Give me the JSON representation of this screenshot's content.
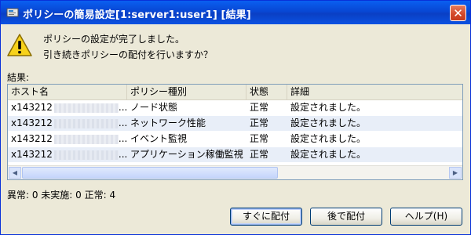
{
  "window": {
    "title": "ポリシーの簡易設定[1:server1:user1] [結果]",
    "close_glyph": "✕"
  },
  "message": {
    "line1": "ポリシーの設定が完了しました。",
    "line2": "引き続きポリシーの配付を行いますか？"
  },
  "result_label": "結果:",
  "table": {
    "columns": [
      "ホスト名",
      "ポリシー種別",
      "状態",
      "詳細"
    ],
    "rows": [
      {
        "host": "x143212",
        "host_suffix": "...",
        "policy": "ノード状態",
        "status": "正常",
        "detail": "設定されました。"
      },
      {
        "host": "x143212",
        "host_suffix": "...",
        "policy": "ネットワーク性能",
        "status": "正常",
        "detail": "設定されました。"
      },
      {
        "host": "x143212",
        "host_suffix": "...",
        "policy": "イベント監視",
        "status": "正常",
        "detail": "設定されました。"
      },
      {
        "host": "x143212",
        "host_suffix": "...",
        "policy": "アプリケーション稼働監視",
        "status": "正常",
        "detail": "設定されました。"
      }
    ]
  },
  "scrollbar": {
    "left_arrow": "◀",
    "right_arrow": "▶"
  },
  "status_line": "異常: 0 未実施: 0 正常: 4",
  "buttons": {
    "deploy_now": "すぐに配付",
    "deploy_later": "後で配付",
    "help": "ヘルプ(H)"
  },
  "colors": {
    "titlebar": "#0a5ff0",
    "window_bg": "#ece9d8",
    "alt_row": "#e8eef8",
    "close_button": "#d2482a"
  }
}
